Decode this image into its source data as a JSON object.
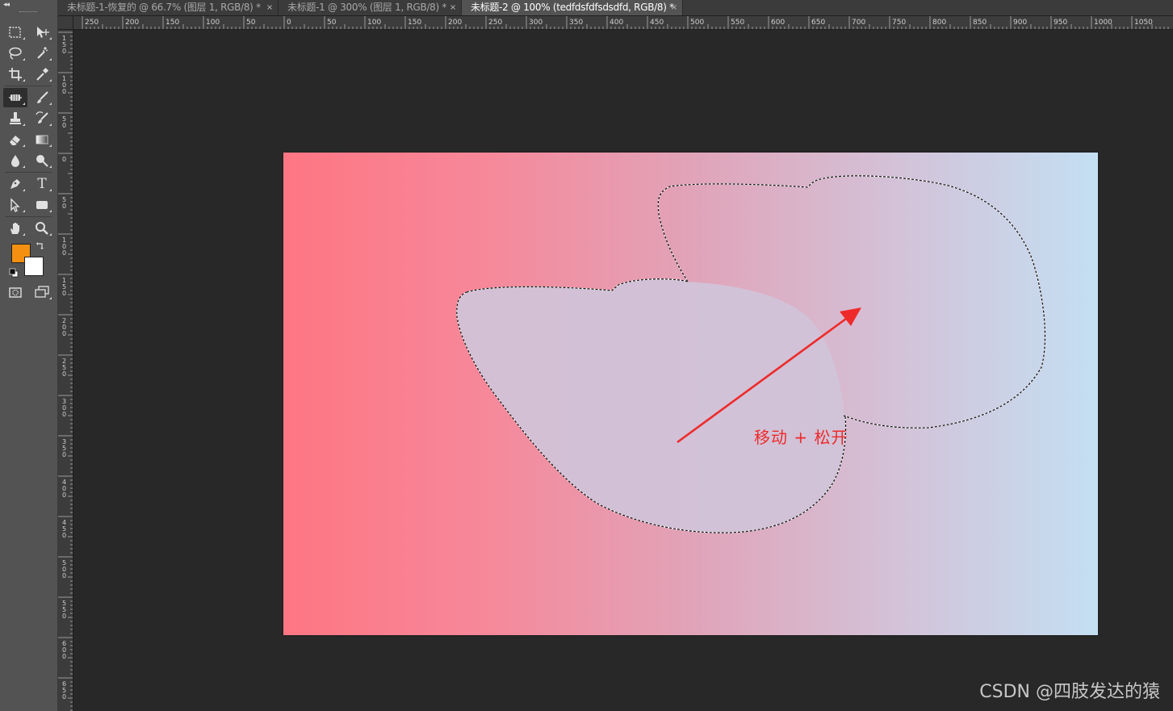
{
  "tabs": [
    {
      "label": "未标题-1-恢复的 @ 66.7% (图层 1, RGB/8) *",
      "active": false
    },
    {
      "label": "未标题-1 @ 300% (图层 1, RGB/8) *",
      "active": false
    },
    {
      "label": "未标题-2 @ 100% (tedfdsfdfsdsdfd, RGB/8) *",
      "active": true
    }
  ],
  "tab_close_glyph": "×",
  "toolbar": {
    "collapse_glyph": "◂◂",
    "tools": [
      {
        "name": "rectangular-marquee-icon"
      },
      {
        "name": "move-icon"
      },
      {
        "name": "lasso-icon"
      },
      {
        "name": "magic-wand-icon"
      },
      {
        "name": "crop-icon"
      },
      {
        "name": "eyedropper-icon"
      },
      {
        "name": "spot-healing-brush-icon",
        "active": true
      },
      {
        "name": "brush-icon"
      },
      {
        "name": "clone-stamp-icon"
      },
      {
        "name": "history-brush-icon"
      },
      {
        "name": "eraser-icon"
      },
      {
        "name": "gradient-icon"
      },
      {
        "name": "blur-icon"
      },
      {
        "name": "dodge-icon"
      },
      {
        "name": "pen-icon"
      },
      {
        "name": "type-icon",
        "glyph": "T"
      },
      {
        "name": "path-selection-icon"
      },
      {
        "name": "rectangle-shape-icon"
      },
      {
        "name": "hand-icon"
      },
      {
        "name": "zoom-icon"
      },
      {
        "name": "quick-mask-icon"
      },
      {
        "name": "screen-mode-icon"
      }
    ],
    "foreground_color": "#f39011",
    "background_color": "#ffffff"
  },
  "ruler_h_labels": [
    "250",
    "200",
    "150",
    "100",
    "50",
    "0",
    "50",
    "100",
    "150",
    "200",
    "250",
    "300",
    "350",
    "400",
    "450",
    "500",
    "550",
    "600",
    "650",
    "700",
    "750",
    "800",
    "850",
    "900",
    "950",
    "1000",
    "1050"
  ],
  "ruler_v_labels": [
    "150",
    "100",
    "50",
    "0",
    "50",
    "100",
    "150",
    "200",
    "250",
    "300",
    "350",
    "400",
    "450",
    "500",
    "550",
    "600",
    "650"
  ],
  "canvas": {
    "gradient_colors": [
      "#fe7683",
      "#e1a3b8",
      "#c4dff3"
    ]
  },
  "annotation": {
    "text": "移动 + 松开",
    "color": "#ee2a2a"
  },
  "watermark": "CSDN @四肢发达的猿"
}
